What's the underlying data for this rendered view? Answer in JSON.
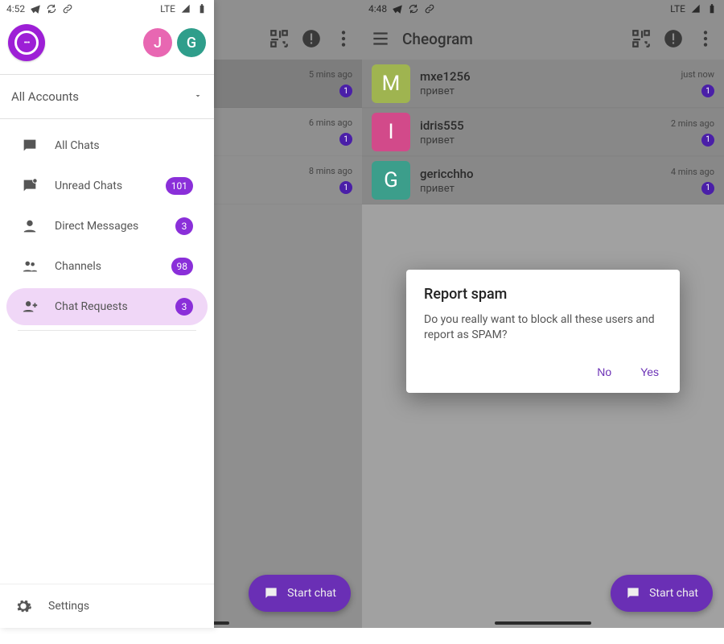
{
  "left": {
    "statusbar": {
      "time": "4:52",
      "network": "LTE"
    },
    "drawer": {
      "accounts_label": "All Accounts",
      "account_avatars": [
        {
          "letter": "J",
          "color": "pink"
        },
        {
          "letter": "G",
          "color": "teal"
        }
      ],
      "nav": [
        {
          "icon": "chat",
          "label": "All Chats",
          "badge": ""
        },
        {
          "icon": "chat-unread",
          "label": "Unread Chats",
          "badge": "101"
        },
        {
          "icon": "person",
          "label": "Direct Messages",
          "badge": "3"
        },
        {
          "icon": "group",
          "label": "Channels",
          "badge": "98"
        },
        {
          "icon": "person-add",
          "label": "Chat Requests",
          "badge": "3",
          "active": true
        }
      ],
      "settings_label": "Settings"
    },
    "partial_chats": [
      {
        "time": "5 mins ago",
        "badge": "1"
      },
      {
        "time": "6 mins ago",
        "badge": "1"
      },
      {
        "time": "8 mins ago",
        "badge": "1"
      }
    ],
    "fab_label": "Start chat"
  },
  "right": {
    "statusbar": {
      "time": "4:48",
      "network": "LTE"
    },
    "toolbar": {
      "title": "Cheogram"
    },
    "chats": [
      {
        "avatar": {
          "letter": "M",
          "cls": "c1"
        },
        "name": "mxe1256",
        "msg": "привет",
        "time": "just now",
        "badge": "1"
      },
      {
        "avatar": {
          "letter": "I",
          "cls": "c2"
        },
        "name": "idris555",
        "msg": "привет",
        "time": "2 mins ago",
        "badge": "1"
      },
      {
        "avatar": {
          "letter": "G",
          "cls": "c3"
        },
        "name": "gericchho",
        "msg": "привет",
        "time": "4 mins ago",
        "badge": "1"
      }
    ],
    "dialog": {
      "title": "Report spam",
      "body": "Do you really want to block all these users and report as SPAM?",
      "no": "No",
      "yes": "Yes"
    },
    "fab_label": "Start chat"
  }
}
